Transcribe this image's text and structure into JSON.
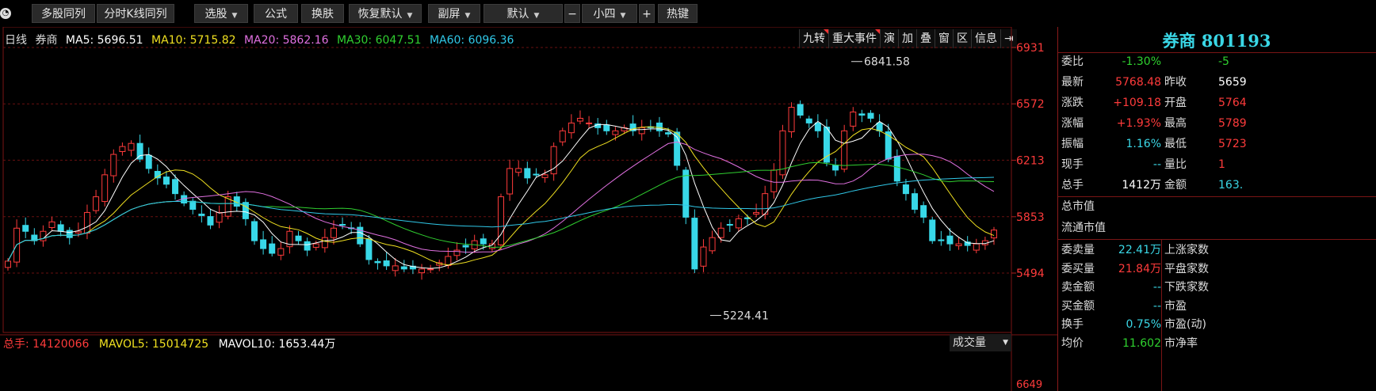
{
  "toolbar": {
    "multi_stock": "多股同列",
    "kline_multi": "分时K线同列",
    "select_stock": "选股",
    "formula": "公式",
    "skin": "换肤",
    "restore_default": "恢复默认",
    "sub_screen": "副屏",
    "default_layout": "默认",
    "minus": "−",
    "font_size": "小四",
    "plus": "+",
    "hotkey": "热键"
  },
  "chart": {
    "period": "日线",
    "name": "券商",
    "ma5": "MA5: 5696.51",
    "ma10": "MA10: 5715.82",
    "ma20": "MA20: 5862.16",
    "ma30": "MA30: 6047.51",
    "ma60": "MA60: 6096.36",
    "tools": [
      "九转",
      "重大事件",
      "演",
      "加",
      "叠",
      "窗",
      "区",
      "信息",
      "⇥"
    ],
    "high_label": "6841.58",
    "low_label": "5224.41",
    "colors": {
      "up": "#ff3b3b",
      "down": "#38d8e8",
      "ma5": "#ffffff",
      "ma10": "#f0e020",
      "ma20": "#e070e0",
      "ma30": "#30d030",
      "ma60": "#30c8e8"
    }
  },
  "chart_data": {
    "type": "candlestick",
    "y_ticks": [
      6931,
      6572,
      6213,
      5853,
      5494,
      6649
    ],
    "ylim": [
      5224.41,
      6931
    ],
    "high": 6841.58,
    "low": 5224.41,
    "close_series": [
      5570,
      5780,
      5760,
      5700,
      5760,
      5820,
      5760,
      5720,
      5760,
      5880,
      5980,
      6120,
      6250,
      6300,
      6320,
      6220,
      6160,
      6100,
      6060,
      6000,
      5940,
      5900,
      5860,
      5800,
      5880,
      5980,
      5920,
      5840,
      5700,
      5650,
      5620,
      5650,
      5760,
      5700,
      5640,
      5680,
      5720,
      5780,
      5800,
      5780,
      5680,
      5580,
      5560,
      5540,
      5540,
      5520,
      5520,
      5520,
      5520,
      5560,
      5600,
      5640,
      5660,
      5700,
      5680,
      5680,
      5980,
      6160,
      6160,
      6100,
      6120,
      6120,
      6300,
      6400,
      6450,
      6480,
      6450,
      6420,
      6400,
      6400,
      6420,
      6400,
      6420,
      6420,
      6400,
      6380,
      6180,
      5850,
      5520,
      5660,
      5720,
      5780,
      5800,
      5840,
      5840,
      5880,
      6000,
      6150,
      6400,
      6550,
      6500,
      6450,
      6400,
      6200,
      6150,
      6400,
      6520,
      6500,
      6480,
      6400,
      6220,
      6080,
      6000,
      5900,
      5850,
      5700,
      5700,
      5680,
      5680,
      5670,
      5680,
      5700,
      5768
    ]
  },
  "volume": {
    "total_label": "总手:",
    "total_value": "14120066",
    "mavol5": "MAVOL5: 15014725",
    "mavol10": "MAVOL10: 1653.44万",
    "selector": "成交量"
  },
  "panel": {
    "title": "券商 801193",
    "rows": [
      {
        "l": "委比",
        "v": "-1.30%",
        "vc": "green",
        "l2": "",
        "v2": "-5",
        "v2c": "green"
      },
      {
        "l": "最新",
        "v": "5768.48",
        "vc": "red",
        "l2": "昨收",
        "v2": "5659",
        "v2c": "white"
      },
      {
        "l": "涨跌",
        "v": "+109.18",
        "vc": "red",
        "l2": "开盘",
        "v2": "5764",
        "v2c": "red"
      },
      {
        "l": "涨幅",
        "v": "+1.93%",
        "vc": "red",
        "l2": "最高",
        "v2": "5789",
        "v2c": "red"
      },
      {
        "l": "振幅",
        "v": "1.16%",
        "vc": "cyan",
        "l2": "最低",
        "v2": "5723",
        "v2c": "red"
      },
      {
        "l": "现手",
        "v": "--",
        "vc": "cyan",
        "l2": "量比",
        "v2": "1",
        "v2c": "red"
      },
      {
        "l": "总手",
        "v": "1412万",
        "vc": "white",
        "l2": "金额",
        "v2": "163.",
        "v2c": "cyan"
      }
    ],
    "market_cap": "总市值",
    "float_cap": "流通市值",
    "rows2": [
      {
        "l": "委卖量",
        "v": "22.41万",
        "vc": "cyan",
        "l2": "上涨家数"
      },
      {
        "l": "委买量",
        "v": "21.84万",
        "vc": "red",
        "l2": "平盘家数"
      },
      {
        "l": "卖金额",
        "v": "--",
        "vc": "cyan",
        "l2": "下跌家数"
      },
      {
        "l": "买金额",
        "v": "--",
        "vc": "cyan",
        "l2": "市盈"
      },
      {
        "l": "换手",
        "v": "0.75%",
        "vc": "cyan",
        "l2": "市盈(动)"
      },
      {
        "l": "均价",
        "v": "11.602",
        "vc": "green",
        "l2": "市净率"
      }
    ]
  }
}
